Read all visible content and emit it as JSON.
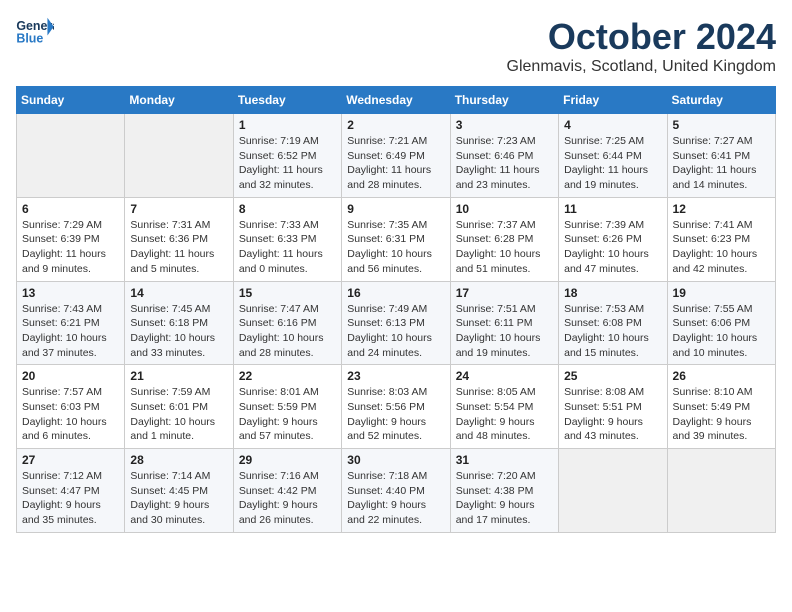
{
  "header": {
    "logo_line1": "General",
    "logo_line2": "Blue",
    "month_title": "October 2024",
    "location": "Glenmavis, Scotland, United Kingdom"
  },
  "weekdays": [
    "Sunday",
    "Monday",
    "Tuesday",
    "Wednesday",
    "Thursday",
    "Friday",
    "Saturday"
  ],
  "weeks": [
    [
      {
        "day": "",
        "text": ""
      },
      {
        "day": "",
        "text": ""
      },
      {
        "day": "1",
        "text": "Sunrise: 7:19 AM\nSunset: 6:52 PM\nDaylight: 11 hours and 32 minutes."
      },
      {
        "day": "2",
        "text": "Sunrise: 7:21 AM\nSunset: 6:49 PM\nDaylight: 11 hours and 28 minutes."
      },
      {
        "day": "3",
        "text": "Sunrise: 7:23 AM\nSunset: 6:46 PM\nDaylight: 11 hours and 23 minutes."
      },
      {
        "day": "4",
        "text": "Sunrise: 7:25 AM\nSunset: 6:44 PM\nDaylight: 11 hours and 19 minutes."
      },
      {
        "day": "5",
        "text": "Sunrise: 7:27 AM\nSunset: 6:41 PM\nDaylight: 11 hours and 14 minutes."
      }
    ],
    [
      {
        "day": "6",
        "text": "Sunrise: 7:29 AM\nSunset: 6:39 PM\nDaylight: 11 hours and 9 minutes."
      },
      {
        "day": "7",
        "text": "Sunrise: 7:31 AM\nSunset: 6:36 PM\nDaylight: 11 hours and 5 minutes."
      },
      {
        "day": "8",
        "text": "Sunrise: 7:33 AM\nSunset: 6:33 PM\nDaylight: 11 hours and 0 minutes."
      },
      {
        "day": "9",
        "text": "Sunrise: 7:35 AM\nSunset: 6:31 PM\nDaylight: 10 hours and 56 minutes."
      },
      {
        "day": "10",
        "text": "Sunrise: 7:37 AM\nSunset: 6:28 PM\nDaylight: 10 hours and 51 minutes."
      },
      {
        "day": "11",
        "text": "Sunrise: 7:39 AM\nSunset: 6:26 PM\nDaylight: 10 hours and 47 minutes."
      },
      {
        "day": "12",
        "text": "Sunrise: 7:41 AM\nSunset: 6:23 PM\nDaylight: 10 hours and 42 minutes."
      }
    ],
    [
      {
        "day": "13",
        "text": "Sunrise: 7:43 AM\nSunset: 6:21 PM\nDaylight: 10 hours and 37 minutes."
      },
      {
        "day": "14",
        "text": "Sunrise: 7:45 AM\nSunset: 6:18 PM\nDaylight: 10 hours and 33 minutes."
      },
      {
        "day": "15",
        "text": "Sunrise: 7:47 AM\nSunset: 6:16 PM\nDaylight: 10 hours and 28 minutes."
      },
      {
        "day": "16",
        "text": "Sunrise: 7:49 AM\nSunset: 6:13 PM\nDaylight: 10 hours and 24 minutes."
      },
      {
        "day": "17",
        "text": "Sunrise: 7:51 AM\nSunset: 6:11 PM\nDaylight: 10 hours and 19 minutes."
      },
      {
        "day": "18",
        "text": "Sunrise: 7:53 AM\nSunset: 6:08 PM\nDaylight: 10 hours and 15 minutes."
      },
      {
        "day": "19",
        "text": "Sunrise: 7:55 AM\nSunset: 6:06 PM\nDaylight: 10 hours and 10 minutes."
      }
    ],
    [
      {
        "day": "20",
        "text": "Sunrise: 7:57 AM\nSunset: 6:03 PM\nDaylight: 10 hours and 6 minutes."
      },
      {
        "day": "21",
        "text": "Sunrise: 7:59 AM\nSunset: 6:01 PM\nDaylight: 10 hours and 1 minute."
      },
      {
        "day": "22",
        "text": "Sunrise: 8:01 AM\nSunset: 5:59 PM\nDaylight: 9 hours and 57 minutes."
      },
      {
        "day": "23",
        "text": "Sunrise: 8:03 AM\nSunset: 5:56 PM\nDaylight: 9 hours and 52 minutes."
      },
      {
        "day": "24",
        "text": "Sunrise: 8:05 AM\nSunset: 5:54 PM\nDaylight: 9 hours and 48 minutes."
      },
      {
        "day": "25",
        "text": "Sunrise: 8:08 AM\nSunset: 5:51 PM\nDaylight: 9 hours and 43 minutes."
      },
      {
        "day": "26",
        "text": "Sunrise: 8:10 AM\nSunset: 5:49 PM\nDaylight: 9 hours and 39 minutes."
      }
    ],
    [
      {
        "day": "27",
        "text": "Sunrise: 7:12 AM\nSunset: 4:47 PM\nDaylight: 9 hours and 35 minutes."
      },
      {
        "day": "28",
        "text": "Sunrise: 7:14 AM\nSunset: 4:45 PM\nDaylight: 9 hours and 30 minutes."
      },
      {
        "day": "29",
        "text": "Sunrise: 7:16 AM\nSunset: 4:42 PM\nDaylight: 9 hours and 26 minutes."
      },
      {
        "day": "30",
        "text": "Sunrise: 7:18 AM\nSunset: 4:40 PM\nDaylight: 9 hours and 22 minutes."
      },
      {
        "day": "31",
        "text": "Sunrise: 7:20 AM\nSunset: 4:38 PM\nDaylight: 9 hours and 17 minutes."
      },
      {
        "day": "",
        "text": ""
      },
      {
        "day": "",
        "text": ""
      }
    ]
  ]
}
